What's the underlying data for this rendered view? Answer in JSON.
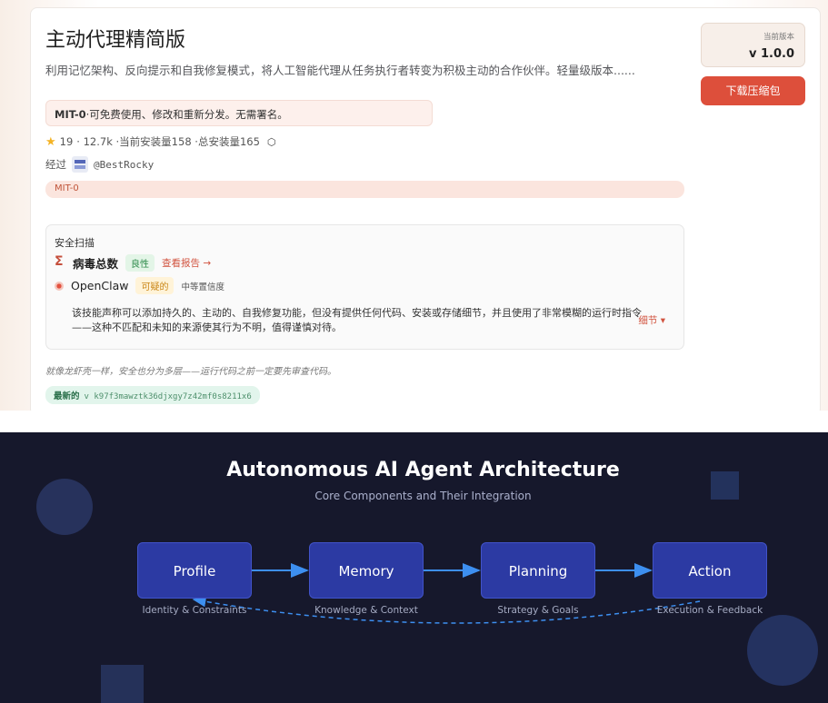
{
  "skill": {
    "title": "主动代理精简版",
    "description": "利用记忆架构、反向提示和自我修复模式，将人工智能代理从任务执行者转变为积极主动的合作伙伴。轻量级版本......",
    "license_name": "MIT-0",
    "license_text": "·可免费使用、修改和重新分发。无需署名。",
    "stars": "19",
    "stats_text": "· 12.7k ·当前安装量158 ·总安装量165",
    "via_label": "经过",
    "author": "@BestRocky",
    "tag": "MIT-0"
  },
  "scan": {
    "title": "安全扫描",
    "virustotal_name": "病毒总数",
    "virustotal_status": "良性",
    "report_link": "查看报告 →",
    "openclaw_name": "OpenClaw",
    "openclaw_status": "可疑的",
    "openclaw_confidence": "中等置信度",
    "summary": "该技能声称可以添加持久的、主动的、自我修复功能，但没有提供任何代码、安装或存储细节，并且使用了非常模糊的运行时指令——这种不匹配和未知的来源使其行为不明，值得谨慎对待。",
    "detail_link": "细节 ▾"
  },
  "note": "就像龙虾壳一样，安全也分为多层——运行代码之前一定要先审查代码。",
  "latest": {
    "label": "最新的",
    "hash": "v k97f3mawztk36djxgy7z42mf0s8211x6"
  },
  "sidebar": {
    "version_label": "当前版本",
    "version": "v 1.0.0",
    "download_label": "下载压缩包"
  },
  "diagram": {
    "title": "Autonomous AI Agent Architecture",
    "subtitle": "Core Components and Their Integration",
    "nodes": [
      {
        "label": "Profile",
        "caption": "Identity & Constraints"
      },
      {
        "label": "Memory",
        "caption": "Knowledge & Context"
      },
      {
        "label": "Planning",
        "caption": "Strategy & Goals"
      },
      {
        "label": "Action",
        "caption": "Execution & Feedback"
      }
    ]
  },
  "colors": {
    "accent": "#dd4f3b",
    "diagram_bg": "#16182c",
    "node_fill": "#2c3aa3",
    "arrow": "#3d8ff0"
  }
}
